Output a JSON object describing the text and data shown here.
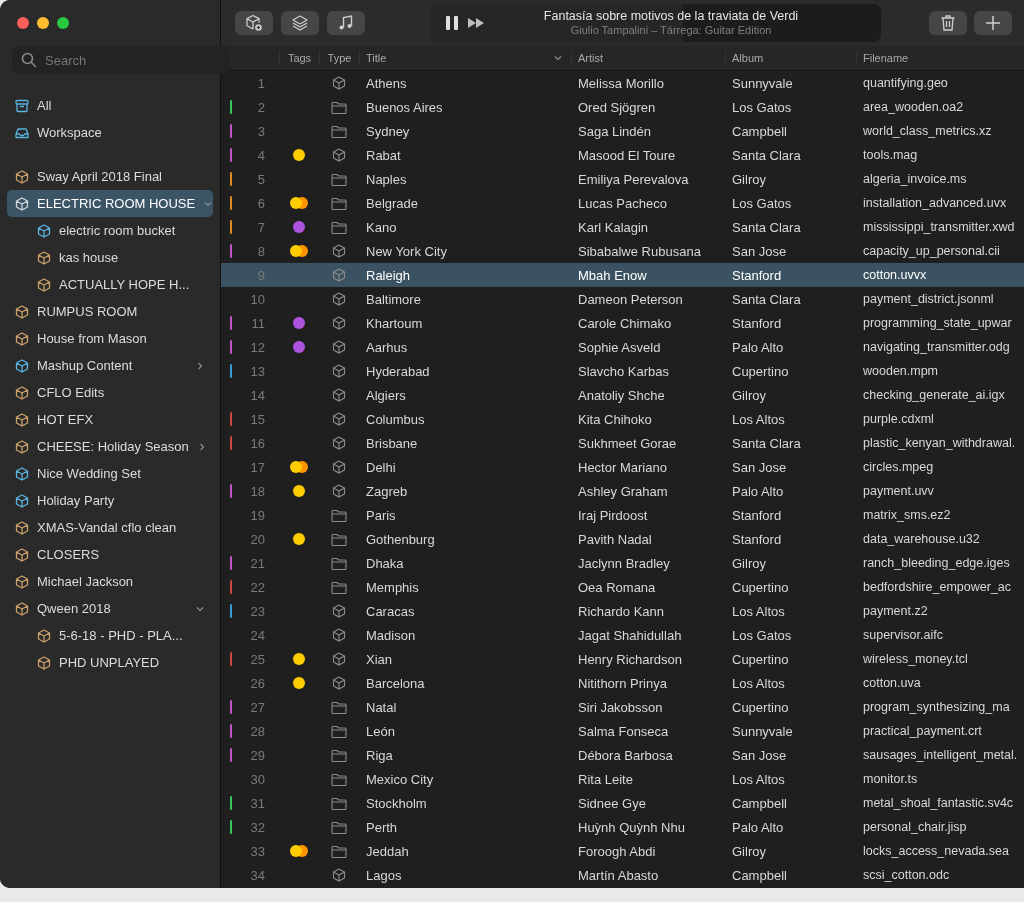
{
  "search": {
    "placeholder": "Search"
  },
  "library": [
    {
      "label": "All",
      "kind": "archive",
      "selected": false
    },
    {
      "label": "Workspace",
      "kind": "tray",
      "selected": false
    }
  ],
  "sidebar": {
    "items": [
      {
        "label": "Sway April 2018 Final",
        "color": "#c9a06a",
        "selected": false
      },
      {
        "label": "ELECTRIC ROOM HOUSE",
        "color": "#cfd6da",
        "selected": true,
        "expanded": true,
        "children": [
          {
            "label": "electric room bucket",
            "color": "#5ab4e0",
            "selected": false
          },
          {
            "label": "kas house",
            "color": "#c9a06a",
            "selected": false
          },
          {
            "label": "ACTUALLY HOPE H...",
            "color": "#c9a06a",
            "selected": false
          }
        ]
      },
      {
        "label": "RUMPUS ROOM",
        "color": "#c9a06a",
        "selected": false
      },
      {
        "label": "House from Mason",
        "color": "#c9a06a",
        "selected": false
      },
      {
        "label": "Mashup Content",
        "color": "#5ab4e0",
        "selected": false,
        "expanded": false
      },
      {
        "label": "CFLO Edits",
        "color": "#c9a06a",
        "selected": false
      },
      {
        "label": "HOT EFX",
        "color": "#c9a06a",
        "selected": false
      },
      {
        "label": "CHEESE: Holiday Season",
        "color": "#c9a06a",
        "selected": false,
        "expanded": false
      },
      {
        "label": "Nice Wedding Set",
        "color": "#5ab4e0",
        "selected": false
      },
      {
        "label": "Holiday Party",
        "color": "#5ab4e0",
        "selected": false
      },
      {
        "label": "XMAS-Vandal cflo clean",
        "color": "#c9a06a",
        "selected": false
      },
      {
        "label": "CLOSERS",
        "color": "#c9a06a",
        "selected": false
      },
      {
        "label": "Michael Jackson",
        "color": "#c9a06a",
        "selected": false
      },
      {
        "label": "Qween 2018",
        "color": "#c9a06a",
        "selected": false,
        "expanded": true,
        "children": [
          {
            "label": "5-6-18 - PHD - PLA...",
            "color": "#c9a06a",
            "selected": false
          },
          {
            "label": "PHD UNPLAYED",
            "color": "#c9a06a",
            "selected": false
          }
        ]
      }
    ]
  },
  "toolbar": {
    "left_buttons": [
      {
        "kind": "package-plus"
      },
      {
        "kind": "layers"
      },
      {
        "kind": "music"
      }
    ],
    "right_buttons": [
      {
        "kind": "trash"
      },
      {
        "kind": "plus"
      }
    ]
  },
  "player": {
    "playing": true,
    "title": "Fantasía sobre motivos de la traviata de Verdi",
    "subtitle": "Giulio Tampalini – Tárrega: Guitar Edition",
    "level": 0.56
  },
  "table": {
    "columns": [
      {
        "label": "Tags"
      },
      {
        "label": "Type"
      },
      {
        "label": "Title",
        "sorted": true
      },
      {
        "label": "Artist"
      },
      {
        "label": "Album"
      },
      {
        "label": "Filename"
      }
    ],
    "rows": [
      {
        "number": "1",
        "tags": [],
        "kind": "package",
        "title": "Athens",
        "artist": "Melissa Morillo",
        "album": "Sunnyvale",
        "filename": "quantifying.geo",
        "selected": false
      },
      {
        "number": "2",
        "color": "#34c759",
        "tags": [],
        "kind": "folder",
        "title": "Buenos Aires",
        "artist": "Ored Sjögren",
        "album": "Los Gatos",
        "filename": "area_wooden.oa2",
        "selected": false
      },
      {
        "number": "3",
        "color": "#c64fc8",
        "tags": [],
        "kind": "folder",
        "title": "Sydney",
        "artist": "Saga Lindén",
        "album": "Campbell",
        "filename": "world_class_metrics.xz",
        "selected": false
      },
      {
        "number": "4",
        "color": "#c64fc8",
        "tags": [
          {
            "color": "#ffcc00"
          }
        ],
        "kind": "package",
        "title": "Rabat",
        "artist": "Masood El Toure",
        "album": "Santa Clara",
        "filename": "tools.mag",
        "selected": false
      },
      {
        "number": "5",
        "color": "#e0891c",
        "tags": [],
        "kind": "folder",
        "title": "Naples",
        "artist": "Emiliya Perevalova",
        "album": "Gilroy",
        "filename": "algeria_invoice.ms",
        "selected": false
      },
      {
        "number": "6",
        "color": "#e0891c",
        "tags": [
          {
            "color": "#ffcc00"
          },
          {
            "color": "#ff9500"
          }
        ],
        "kind": "folder",
        "title": "Belgrade",
        "artist": "Lucas Pacheco",
        "album": "Los Gatos",
        "filename": "installation_advanced.uvx",
        "selected": false
      },
      {
        "number": "7",
        "color": "#e0891c",
        "tags": [
          {
            "color": "#af52de"
          }
        ],
        "kind": "folder",
        "title": "Kano",
        "artist": "Karl Kalagin",
        "album": "Santa Clara",
        "filename": "mississippi_transmitter.xwd",
        "selected": false
      },
      {
        "number": "8",
        "color": "#c64fc8",
        "tags": [
          {
            "color": "#ffcc00"
          },
          {
            "color": "#ff9500"
          }
        ],
        "kind": "package",
        "title": "New York City",
        "artist": "Sibabalwe Rubusana",
        "album": "San Jose",
        "filename": "capacity_up_personal.cii",
        "selected": false
      },
      {
        "number": "9",
        "tags": [],
        "kind": "package",
        "title": "Raleigh",
        "artist": "Mbah Enow",
        "album": "Stanford",
        "filename": "cotton.uvvx",
        "selected": true
      },
      {
        "number": "10",
        "tags": [],
        "kind": "package",
        "title": "Baltimore",
        "artist": "Dameon Peterson",
        "album": "Santa Clara",
        "filename": "payment_district.jsonml",
        "selected": false
      },
      {
        "number": "11",
        "color": "#c64fc8",
        "tags": [
          {
            "color": "#af52de"
          }
        ],
        "kind": "package",
        "title": "Khartoum",
        "artist": "Carole Chimako",
        "album": "Stanford",
        "filename": "programming_state_upwar",
        "selected": false
      },
      {
        "number": "12",
        "color": "#c64fc8",
        "tags": [
          {
            "color": "#af52de"
          }
        ],
        "kind": "package",
        "title": "Aarhus",
        "artist": "Sophie Asveld",
        "album": "Palo Alto",
        "filename": "navigating_transmitter.odg",
        "selected": false
      },
      {
        "number": "13",
        "color": "#3a9ad9",
        "tags": [],
        "kind": "package",
        "title": "Hyderabad",
        "artist": "Slavcho Karbas",
        "album": "Cupertino",
        "filename": "wooden.mpm",
        "selected": false
      },
      {
        "number": "14",
        "tags": [],
        "kind": "package",
        "title": "Algiers",
        "artist": "Anatoliy Shche",
        "album": "Gilroy",
        "filename": "checking_generate_ai.igx",
        "selected": false
      },
      {
        "number": "15",
        "color": "#d0453f",
        "tags": [],
        "kind": "package",
        "title": "Columbus",
        "artist": "Kita Chihoko",
        "album": "Los Altos",
        "filename": "purple.cdxml",
        "selected": false
      },
      {
        "number": "16",
        "color": "#d0453f",
        "tags": [],
        "kind": "package",
        "title": "Brisbane",
        "artist": "Sukhmeet Gorae",
        "album": "Santa Clara",
        "filename": "plastic_kenyan_withdrawal.",
        "selected": false
      },
      {
        "number": "17",
        "tags": [
          {
            "color": "#ffcc00"
          },
          {
            "color": "#ff9500"
          }
        ],
        "kind": "package",
        "title": "Delhi",
        "artist": "Hector Mariano",
        "album": "San Jose",
        "filename": "circles.mpeg",
        "selected": false
      },
      {
        "number": "18",
        "color": "#c64fc8",
        "tags": [
          {
            "color": "#ffcc00"
          }
        ],
        "kind": "package",
        "title": "Zagreb",
        "artist": "Ashley Graham",
        "album": "Palo Alto",
        "filename": "payment.uvv",
        "selected": false
      },
      {
        "number": "19",
        "tags": [],
        "kind": "folder",
        "title": "Paris",
        "artist": "Iraj Pirdoost",
        "album": "Stanford",
        "filename": "matrix_sms.ez2",
        "selected": false
      },
      {
        "number": "20",
        "tags": [
          {
            "color": "#ffcc00"
          }
        ],
        "kind": "folder",
        "title": "Gothenburg",
        "artist": "Pavith Nadal",
        "album": "Stanford",
        "filename": "data_warehouse.u32",
        "selected": false
      },
      {
        "number": "21",
        "color": "#c64fc8",
        "tags": [],
        "kind": "folder",
        "title": "Dhaka",
        "artist": "Jaclynn Bradley",
        "album": "Gilroy",
        "filename": "ranch_bleeding_edge.iges",
        "selected": false
      },
      {
        "number": "22",
        "color": "#d0453f",
        "tags": [],
        "kind": "folder",
        "title": "Memphis",
        "artist": "Oea Romana",
        "album": "Cupertino",
        "filename": "bedfordshire_empower_ac",
        "selected": false
      },
      {
        "number": "23",
        "color": "#3a9ad9",
        "tags": [],
        "kind": "package",
        "title": "Caracas",
        "artist": "Richardo Kann",
        "album": "Los Altos",
        "filename": "payment.z2",
        "selected": false
      },
      {
        "number": "24",
        "tags": [],
        "kind": "package",
        "title": "Madison",
        "artist": "Jagat Shahidullah",
        "album": "Los Gatos",
        "filename": "supervisor.aifc",
        "selected": false
      },
      {
        "number": "25",
        "color": "#d0453f",
        "tags": [
          {
            "color": "#ffcc00"
          }
        ],
        "kind": "package",
        "title": "Xian",
        "artist": "Henry Richardson",
        "album": "Cupertino",
        "filename": "wireless_money.tcl",
        "selected": false
      },
      {
        "number": "26",
        "tags": [
          {
            "color": "#ffcc00"
          }
        ],
        "kind": "package",
        "title": "Barcelona",
        "artist": "Nitithorn Prinya",
        "album": "Los Altos",
        "filename": "cotton.uva",
        "selected": false
      },
      {
        "number": "27",
        "color": "#c64fc8",
        "tags": [],
        "kind": "folder",
        "title": "Natal",
        "artist": "Siri Jakobsson",
        "album": "Cupertino",
        "filename": "program_synthesizing_ma",
        "selected": false
      },
      {
        "number": "28",
        "color": "#c64fc8",
        "tags": [],
        "kind": "folder",
        "title": "León",
        "artist": "Salma Fonseca",
        "album": "Sunnyvale",
        "filename": "practical_payment.crt",
        "selected": false
      },
      {
        "number": "29",
        "color": "#c64fc8",
        "tags": [],
        "kind": "folder",
        "title": "Riga",
        "artist": "Débora Barbosa",
        "album": "San Jose",
        "filename": "sausages_intelligent_metal.",
        "selected": false
      },
      {
        "number": "30",
        "tags": [],
        "kind": "folder",
        "title": "Mexico City",
        "artist": "Rita Leite",
        "album": "Los Altos",
        "filename": "monitor.ts",
        "selected": false
      },
      {
        "number": "31",
        "color": "#34c759",
        "tags": [],
        "kind": "folder",
        "title": "Stockholm",
        "artist": "Sidnee Gye",
        "album": "Campbell",
        "filename": "metal_shoal_fantastic.sv4c",
        "selected": false
      },
      {
        "number": "32",
        "color": "#34c759",
        "tags": [],
        "kind": "folder",
        "title": "Perth",
        "artist": "Huỳnh Quỳnh Nhu",
        "album": "Palo Alto",
        "filename": "personal_chair.jisp",
        "selected": false
      },
      {
        "number": "33",
        "tags": [
          {
            "color": "#ffcc00"
          },
          {
            "color": "#ff9500"
          }
        ],
        "kind": "folder",
        "title": "Jeddah",
        "artist": "Foroogh Abdi",
        "album": "Gilroy",
        "filename": "locks_access_nevada.sea",
        "selected": false
      },
      {
        "number": "34",
        "tags": [],
        "kind": "package",
        "title": "Lagos",
        "artist": "Martín Abasto",
        "album": "Campbell",
        "filename": "scsi_cotton.odc",
        "selected": false
      }
    ]
  }
}
